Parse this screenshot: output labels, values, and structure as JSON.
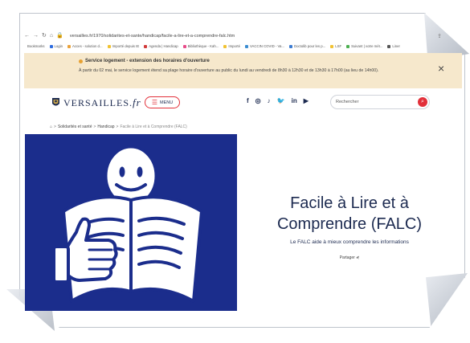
{
  "browser": {
    "url": "versailles.fr/1970/solidarites-et-sante/handicap/facile-a-lire-et-a-comprendre-falc.htm",
    "back_icon": "back-arrow-icon",
    "bookmarks": [
      {
        "label": "Bookmarks",
        "color": "#ffffff"
      },
      {
        "label": "Login",
        "color": "#2d6cdf"
      },
      {
        "label": "Acces - solution d...",
        "color": "#e9a23b"
      },
      {
        "label": "Importé depuis IE",
        "color": "#f1c232"
      },
      {
        "label": "Agenda | Handicap",
        "color": "#d13b3b"
      },
      {
        "label": "Bibliothèque - Kah...",
        "color": "#e84d8a"
      },
      {
        "label": "Importé",
        "color": "#f1c232"
      },
      {
        "label": "VACCIN COVID - Va...",
        "color": "#3b8dd1"
      },
      {
        "label": "Doctolib pour les p...",
        "color": "#3b7bd1"
      },
      {
        "label": "LSF",
        "color": "#f1c232"
      },
      {
        "label": "Suivant | votre mét...",
        "color": "#4caf50"
      },
      {
        "label": "Liner",
        "color": "#555555"
      }
    ]
  },
  "notice": {
    "title": "Service logement - extension des horaires d'ouverture",
    "text": "À partir du 02 mai, le service logement étend sa plage horaire d'ouverture au public du lundi au vendredi de 8h30 à 12h30 et de 13h30 à 17h00 (au lieu de 14h00).",
    "close": "×"
  },
  "header": {
    "logo_text": "VERSAILLES.",
    "logo_suffix": "fr",
    "menu_label": "MENU",
    "menu_icon": "☰",
    "socials": [
      "f",
      "◎",
      "♪",
      "🐦",
      "in",
      "▶"
    ],
    "search_placeholder": "Rechercher",
    "search_icon": "⌕"
  },
  "breadcrumb": {
    "home_icon": "⌂",
    "items": [
      "Solidarités et santé",
      "Handicap",
      "Facile à Lire et à Comprendre (FALC)"
    ],
    "sep": ">"
  },
  "hero": {
    "title": "Facile à Lire et à Comprendre (FALC)",
    "subtitle": "Le FALC aide à mieux comprendre les informations",
    "share": "Partager ⋞"
  },
  "colors": {
    "accent": "#e2303a",
    "brand": "#1c2a50",
    "illustration_bg": "#1b2d8c",
    "notice_bg": "#f6e8cc"
  }
}
